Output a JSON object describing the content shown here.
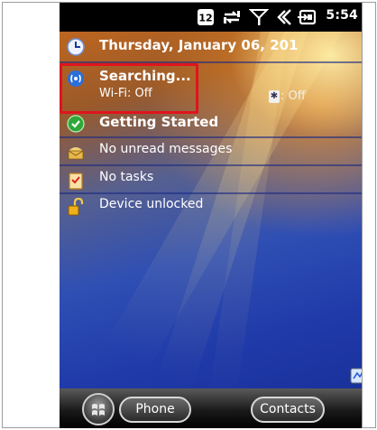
{
  "status_bar": {
    "time": "5:54",
    "icons": [
      "notification-12-icon",
      "data-sync-icon",
      "signal-icon",
      "speaker-icon",
      "battery-charging-icon"
    ],
    "notification_number": "12"
  },
  "today": {
    "date": "Thursday, January 06, 201",
    "wifi_title": "Searching...",
    "wifi_status": "Wi-Fi: Off",
    "bluetooth_status": ": Off",
    "getting_started": "Getting Started",
    "messages": "No unread messages",
    "tasks": "No tasks",
    "device_lock": "Device unlocked"
  },
  "taskbar": {
    "left_softkey": "Phone",
    "right_softkey": "Contacts"
  },
  "colors": {
    "highlight_border": "#e0141e",
    "background_orange": "#c96a1c",
    "background_blue": "#1f39a8"
  }
}
